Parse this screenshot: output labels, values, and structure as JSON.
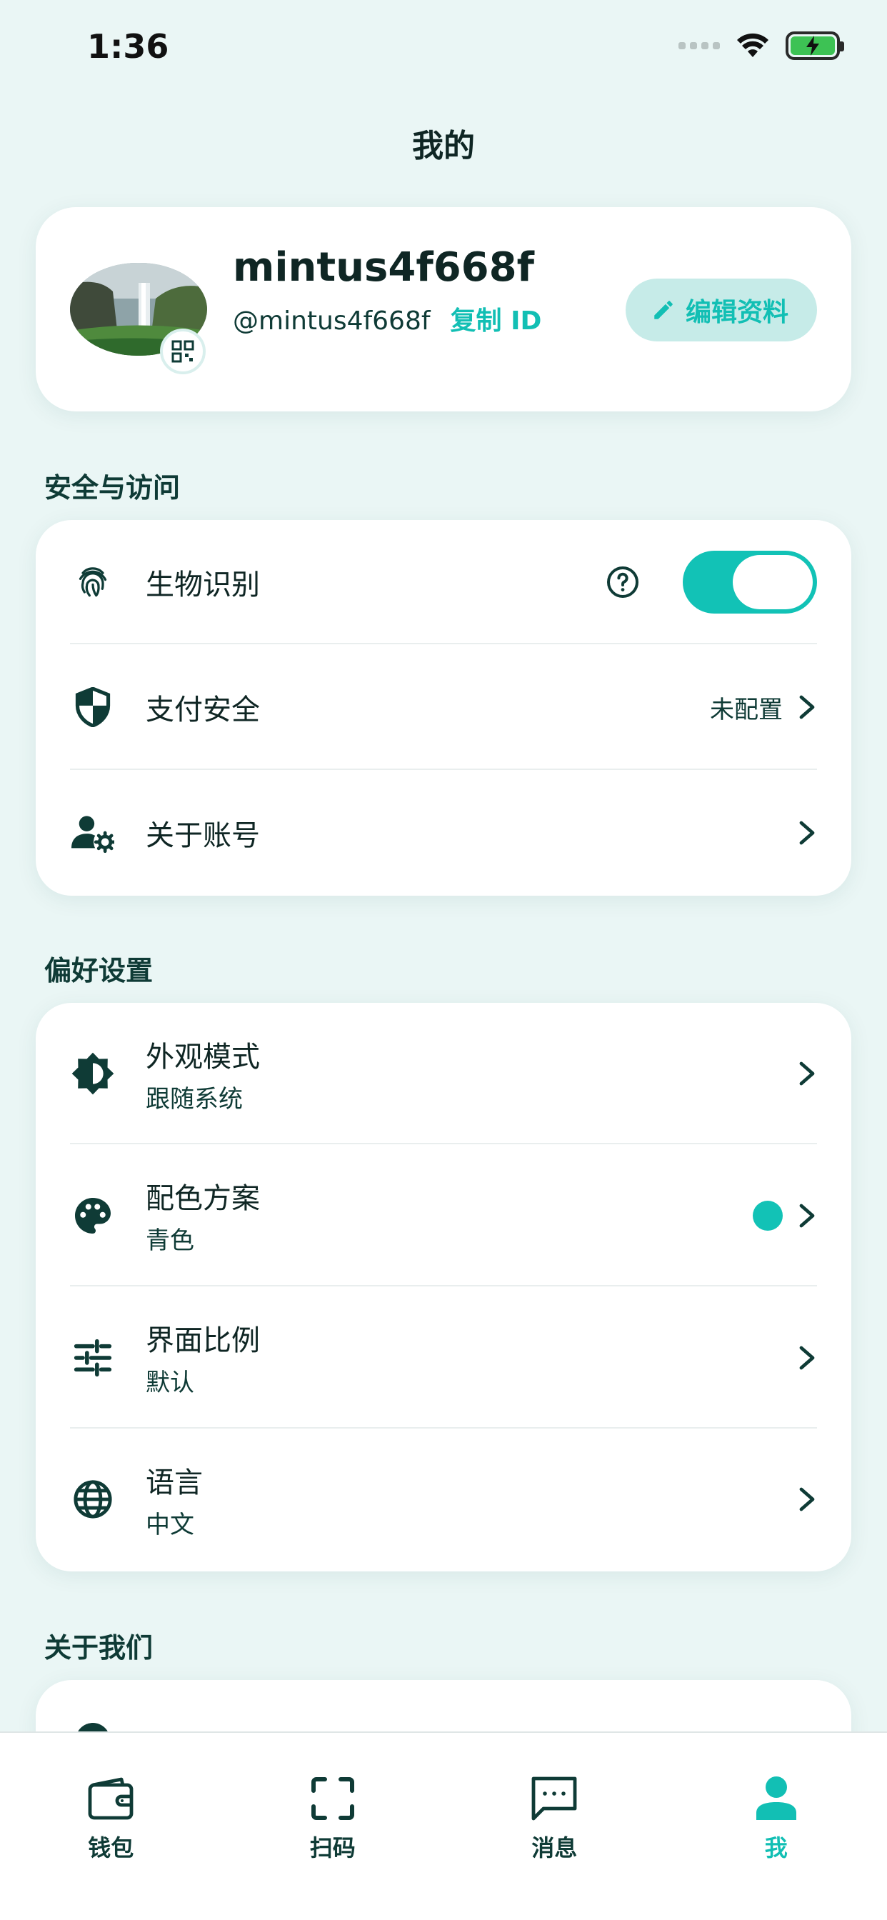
{
  "status_bar": {
    "time": "1:36"
  },
  "header": {
    "title": "我的"
  },
  "profile": {
    "username": "mintus4f668f",
    "handle": "@mintus4f668f",
    "copy_id_label": "复制 ID",
    "edit_label": "编辑资料"
  },
  "sections": {
    "security": {
      "title": "安全与访问",
      "items": [
        {
          "label": "生物识别",
          "icon": "fingerprint-icon",
          "toggle_on": true
        },
        {
          "label": "支付安全",
          "icon": "shield-icon",
          "value": "未配置"
        },
        {
          "label": "关于账号",
          "icon": "user-settings-icon"
        }
      ]
    },
    "preferences": {
      "title": "偏好设置",
      "items": [
        {
          "label": "外观模式",
          "sublabel": "跟随系统",
          "icon": "brightness-icon"
        },
        {
          "label": "配色方案",
          "sublabel": "青色",
          "icon": "palette-icon",
          "color": "#12c2b6"
        },
        {
          "label": "界面比例",
          "sublabel": "默认",
          "icon": "sliders-icon"
        },
        {
          "label": "语言",
          "sublabel": "中文",
          "icon": "globe-icon"
        }
      ]
    },
    "about": {
      "title": "关于我们"
    }
  },
  "tab_bar": {
    "items": [
      {
        "label": "钱包",
        "icon": "wallet-icon"
      },
      {
        "label": "扫码",
        "icon": "scan-icon"
      },
      {
        "label": "消息",
        "icon": "message-icon"
      },
      {
        "label": "我",
        "icon": "person-icon",
        "active": true
      }
    ]
  },
  "colors": {
    "accent": "#12c2b6",
    "background": "#eaf6f5",
    "primary_text": "#0f3b36"
  }
}
